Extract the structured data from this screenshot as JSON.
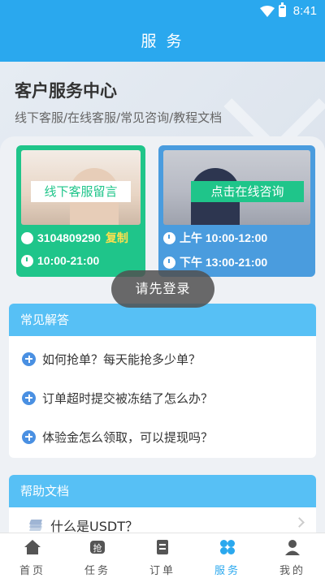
{
  "status": {
    "time": "8:41"
  },
  "title": "服 务",
  "hero": {
    "title": "客户服务中心",
    "subtitle": "线下客服/在线客服/常见咨询/教程文档"
  },
  "offline_card": {
    "label": "线下客服留言",
    "phone": "3104809290",
    "copy": "复制",
    "hours": "10:00-21:00"
  },
  "online_card": {
    "label": "点击在线咨询",
    "am": "上午 10:00-12:00",
    "pm": "下午 13:00-21:00"
  },
  "toast": "请先登录",
  "faq": {
    "header": "常见解答",
    "items": [
      "如何抢单？每天能抢多少单？",
      "订单超时提交被冻结了怎么办？",
      "体验金怎么领取，可以提现吗？"
    ]
  },
  "help": {
    "header": "帮助文档",
    "items": [
      "什么是USDT？"
    ]
  },
  "tabs": [
    {
      "label": "首页",
      "icon": "home-icon"
    },
    {
      "label": "任务",
      "icon": "grab-icon"
    },
    {
      "label": "订单",
      "icon": "order-icon"
    },
    {
      "label": "服务",
      "icon": "service-icon"
    },
    {
      "label": "我的",
      "icon": "user-icon"
    }
  ],
  "colors": {
    "primary": "#2aa8ee",
    "green": "#1fc58a",
    "blue_card": "#4a9cde",
    "section_head": "#57c0f5"
  }
}
